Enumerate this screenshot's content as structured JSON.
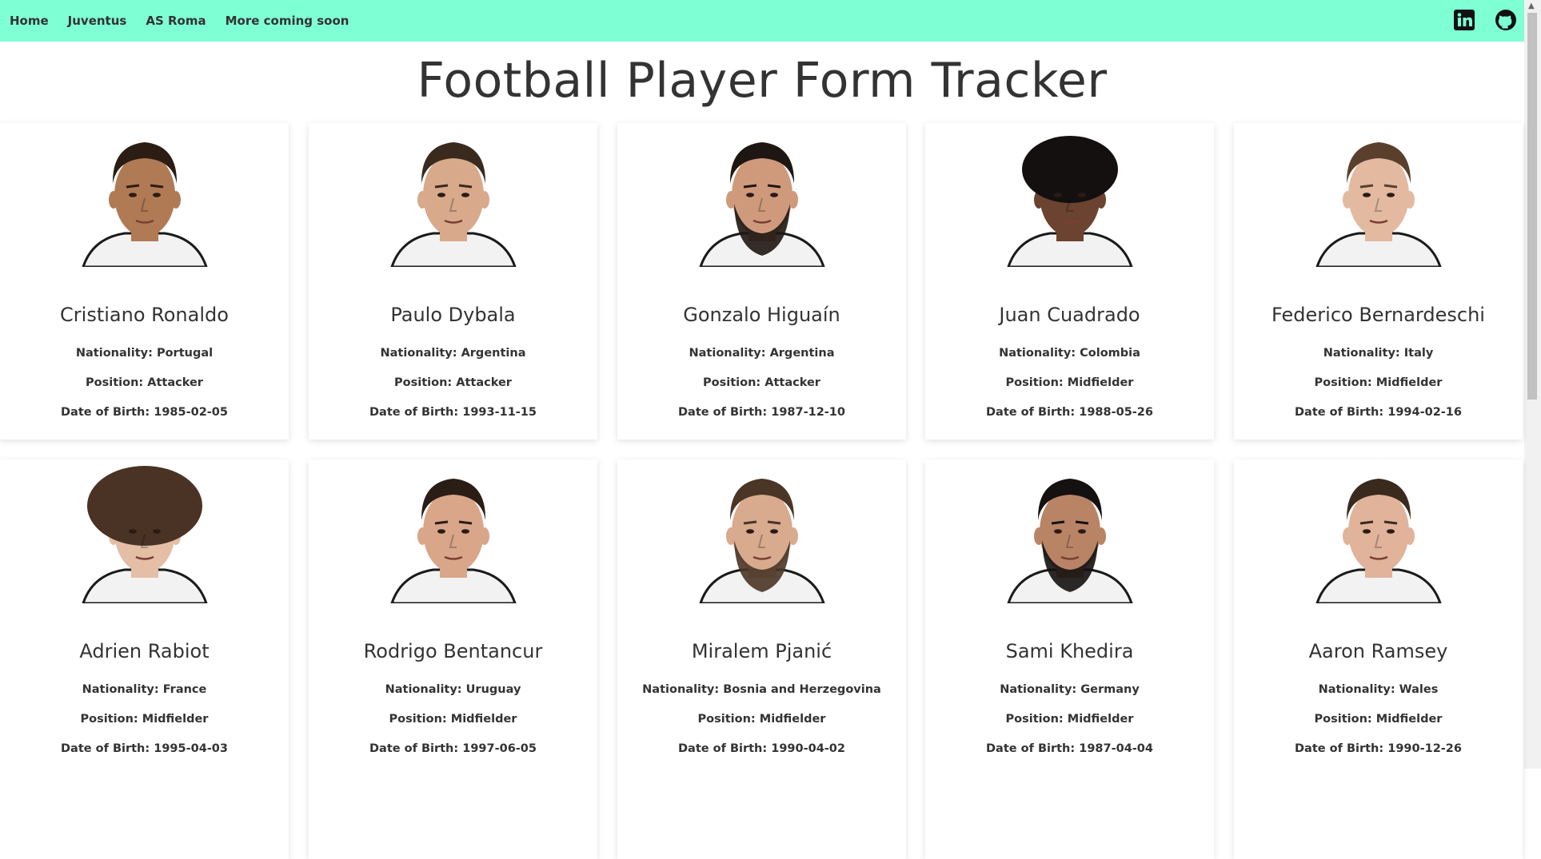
{
  "nav": {
    "links": [
      "Home",
      "Juventus",
      "AS Roma",
      "More coming soon"
    ],
    "social": [
      "linkedin-icon",
      "github-icon"
    ]
  },
  "page": {
    "title": "Football Player Form Tracker"
  },
  "labels": {
    "nationality": "Nationality: ",
    "position": "Position: ",
    "dob": "Date of Birth: "
  },
  "players": [
    {
      "name": "Cristiano Ronaldo",
      "nationality": "Portugal",
      "position": "Attacker",
      "dob": "1985-02-05",
      "skin": "#b07a55",
      "hair": "#2b1d14",
      "beard": false,
      "curly": false
    },
    {
      "name": "Paulo Dybala",
      "nationality": "Argentina",
      "position": "Attacker",
      "dob": "1993-11-15",
      "skin": "#d8a98b",
      "hair": "#3a2a1e",
      "beard": false,
      "curly": false
    },
    {
      "name": "Gonzalo Higuaín",
      "nationality": "Argentina",
      "position": "Attacker",
      "dob": "1987-12-10",
      "skin": "#cf9a7c",
      "hair": "#1e1612",
      "beard": true,
      "curly": false
    },
    {
      "name": "Juan Cuadrado",
      "nationality": "Colombia",
      "position": "Midfielder",
      "dob": "1988-05-26",
      "skin": "#6b4330",
      "hair": "#141010",
      "beard": false,
      "curly": true
    },
    {
      "name": "Federico Bernardeschi",
      "nationality": "Italy",
      "position": "Midfielder",
      "dob": "1994-02-16",
      "skin": "#e3b9a0",
      "hair": "#5a3f2c",
      "beard": false,
      "curly": false
    },
    {
      "name": "Adrien Rabiot",
      "nationality": "France",
      "position": "Midfielder",
      "dob": "1995-04-03",
      "skin": "#e4bea5",
      "hair": "#4a3324",
      "beard": false,
      "curly": true
    },
    {
      "name": "Rodrigo Bentancur",
      "nationality": "Uruguay",
      "position": "Midfielder",
      "dob": "1997-06-05",
      "skin": "#d9a68a",
      "hair": "#2a1d15",
      "beard": false,
      "curly": false
    },
    {
      "name": "Miralem Pjanić",
      "nationality": "Bosnia and Herzegovina",
      "position": "Midfielder",
      "dob": "1990-04-02",
      "skin": "#d8ab8e",
      "hair": "#4a3526",
      "beard": true,
      "curly": false
    },
    {
      "name": "Sami Khedira",
      "nationality": "Germany",
      "position": "Midfielder",
      "dob": "1987-04-04",
      "skin": "#b98466",
      "hair": "#141110",
      "beard": true,
      "curly": false
    },
    {
      "name": "Aaron Ramsey",
      "nationality": "Wales",
      "position": "Midfielder",
      "dob": "1990-12-26",
      "skin": "#e0b39a",
      "hair": "#3a2a1e",
      "beard": false,
      "curly": false
    }
  ]
}
